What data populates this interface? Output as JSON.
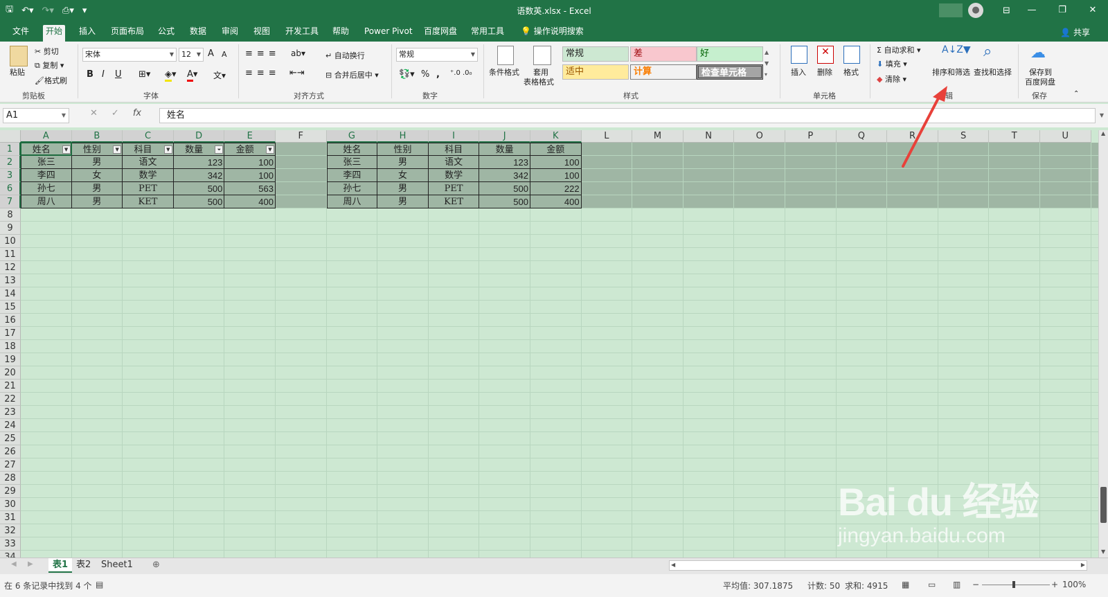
{
  "window": {
    "title": "语数英.xlsx - Excel",
    "controls": [
      "—",
      "❐",
      "✕"
    ],
    "ribbon_display_icon": "ribbon-display-options-icon"
  },
  "tabs": [
    "文件",
    "开始",
    "插入",
    "页面布局",
    "公式",
    "数据",
    "审阅",
    "视图",
    "开发工具",
    "帮助",
    "Power Pivot",
    "百度网盘",
    "常用工具"
  ],
  "active_tab": "开始",
  "tell_me": "操作说明搜索",
  "share": "共享",
  "ribbon": {
    "clipboard": {
      "paste": "粘贴",
      "cut": "剪切",
      "copy": "复制",
      "format_painter": "格式刷",
      "label": "剪贴板"
    },
    "font": {
      "name": "宋体",
      "size": "12",
      "bold": "B",
      "italic": "I",
      "underline": "U",
      "grow": "A",
      "shrink": "A",
      "label": "字体"
    },
    "alignment": {
      "wrap": "自动换行",
      "merge": "合并后居中",
      "label": "对齐方式"
    },
    "number": {
      "format": "常规",
      "percent": "%",
      "comma": ",",
      "label": "数字"
    },
    "styles": {
      "conditional": "条件格式",
      "table_line1": "套用",
      "table_line2": "表格格式",
      "cells": [
        "常规",
        "差",
        "好",
        "适中",
        "计算",
        "检查单元格"
      ],
      "label": "样式"
    },
    "cells_group": {
      "insert": "插入",
      "delete": "删除",
      "format": "格式",
      "label": "单元格"
    },
    "editing": {
      "autosum": "自动求和",
      "fill": "填充",
      "clear": "清除",
      "sort_filter": "排序和筛选",
      "find_select": "查找和选择",
      "label": "编辑"
    },
    "save": {
      "line1": "保存到",
      "line2": "百度网盘",
      "label": "保存"
    }
  },
  "formula_bar": {
    "name_box": "A1",
    "cancel": "✕",
    "enter": "✓",
    "fx": "fx",
    "content": "姓名"
  },
  "columns": [
    "A",
    "B",
    "C",
    "D",
    "E",
    "F",
    "G",
    "H",
    "I",
    "J",
    "K",
    "L",
    "M",
    "N",
    "O",
    "P",
    "Q",
    "R",
    "S",
    "T",
    "U"
  ],
  "rows": [
    "1",
    "2",
    "3",
    "6",
    "7",
    "8",
    "9",
    "10",
    "11",
    "12",
    "13",
    "14",
    "15",
    "16",
    "17",
    "18",
    "19",
    "20",
    "21",
    "22",
    "23",
    "24",
    "25",
    "26",
    "27",
    "28",
    "29",
    "30",
    "31",
    "32",
    "33",
    "34"
  ],
  "table_left": {
    "headers": [
      "姓名",
      "性别",
      "科目",
      "数量",
      "金额"
    ],
    "rows": [
      [
        "张三",
        "男",
        "语文",
        "123",
        "100"
      ],
      [
        "李四",
        "女",
        "数学",
        "342",
        "100"
      ],
      [
        "孙七",
        "男",
        "PET",
        "500",
        "563"
      ],
      [
        "周八",
        "男",
        "KET",
        "500",
        "400"
      ]
    ]
  },
  "table_right": {
    "headers": [
      "姓名",
      "性别",
      "科目",
      "数量",
      "金额"
    ],
    "rows": [
      [
        "张三",
        "男",
        "语文",
        "123",
        "100"
      ],
      [
        "李四",
        "女",
        "数学",
        "342",
        "100"
      ],
      [
        "孙七",
        "男",
        "PET",
        "500",
        "222"
      ],
      [
        "周八",
        "男",
        "KET",
        "500",
        "400"
      ]
    ]
  },
  "sheets": [
    "表1",
    "表2",
    "Sheet1"
  ],
  "active_sheet": "表1",
  "status": {
    "filter_info": "在 6 条记录中找到 4 个",
    "average": "平均值: 307.1875",
    "count": "计数: 50",
    "sum": "求和: 4915",
    "zoom": "100%"
  },
  "watermark": {
    "logo": "Bai du 经验",
    "url": "jingyan.baidu.com"
  },
  "colors": {
    "excel_green": "#217346",
    "sheet_bg": "#cde8d2",
    "selection": "#9fb6a4",
    "annotation_arrow": "#e8413a"
  }
}
